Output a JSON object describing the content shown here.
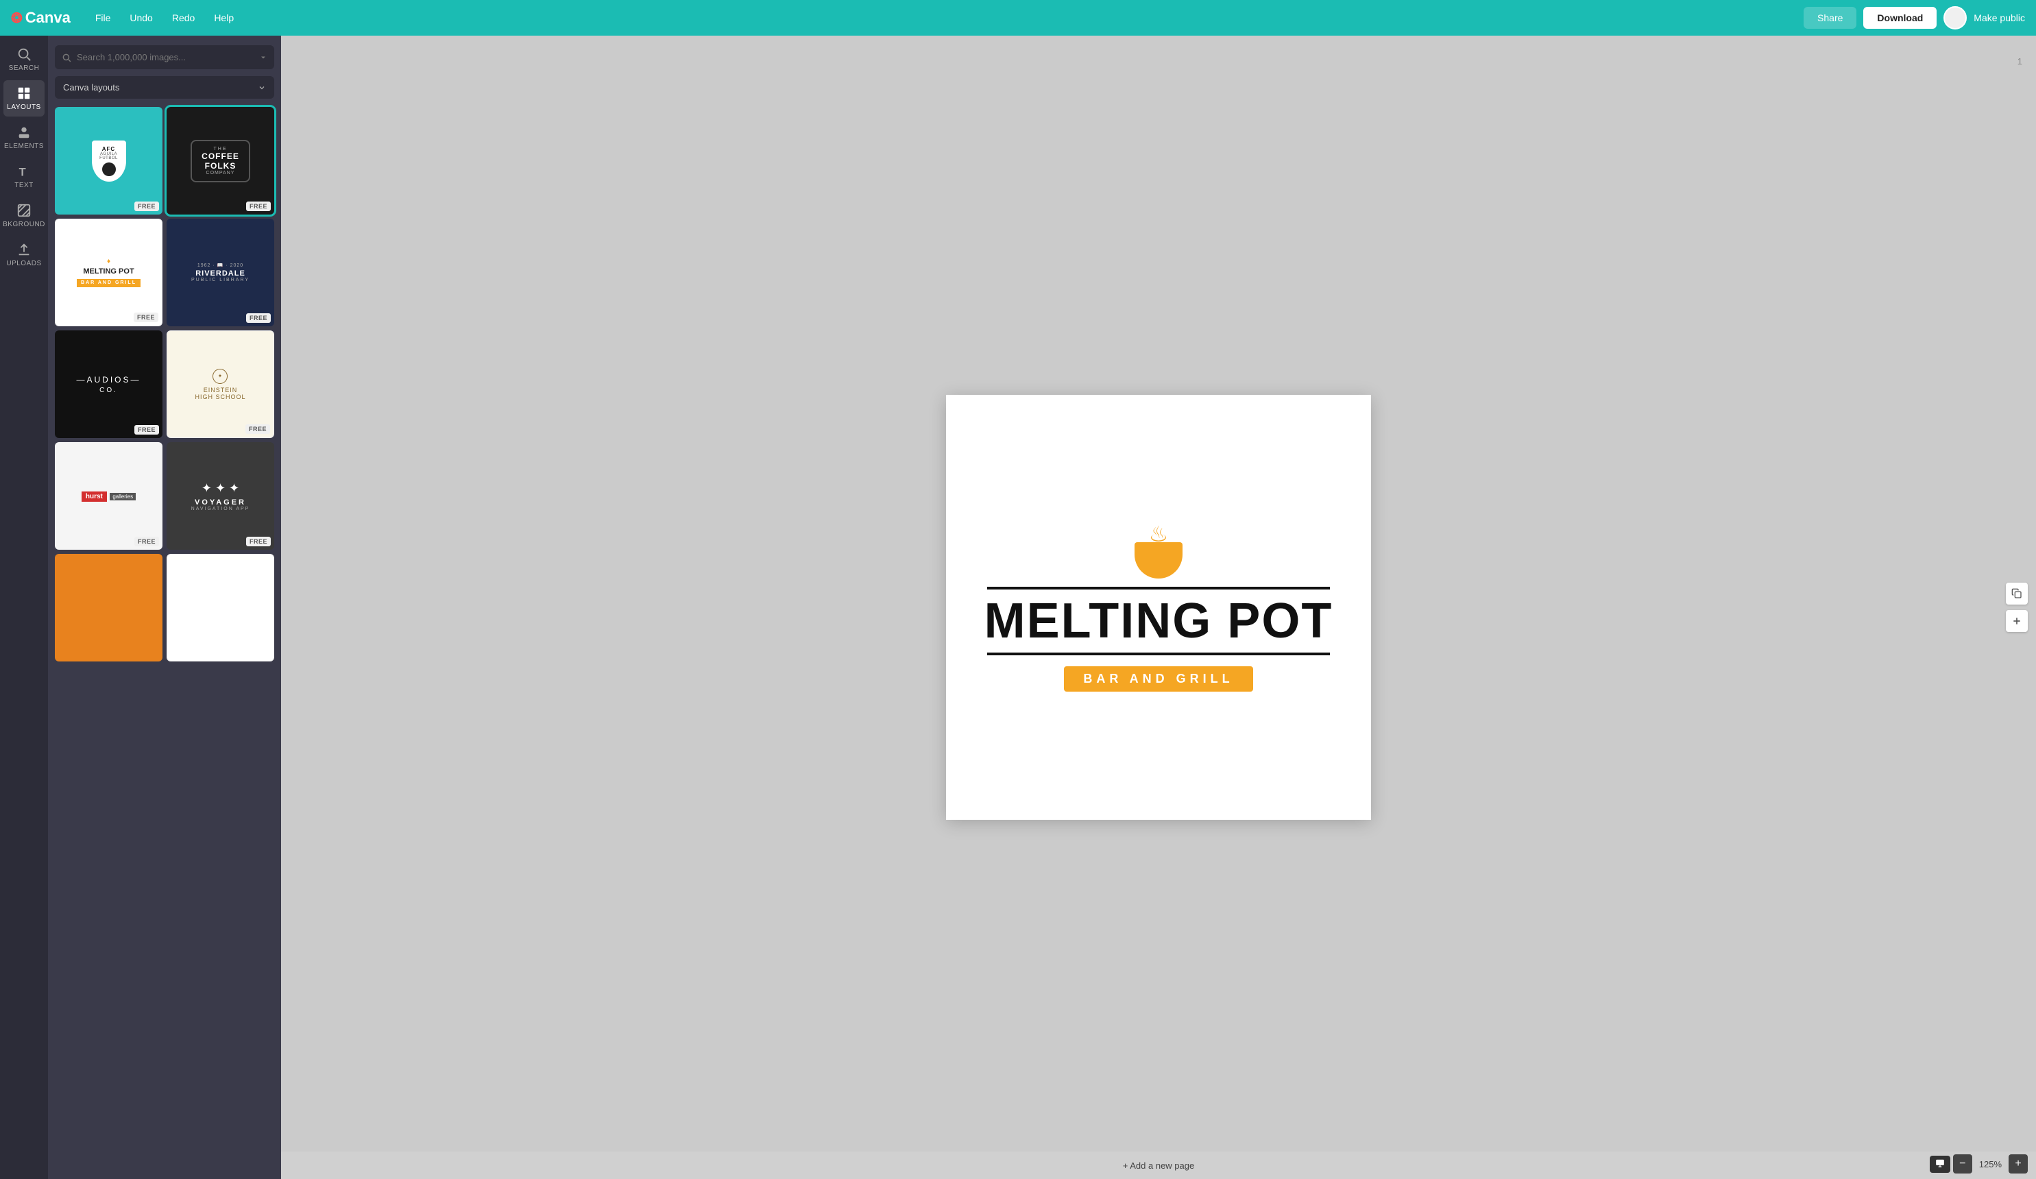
{
  "topbar": {
    "logo": "Canva",
    "menu": [
      "File",
      "Undo",
      "Redo",
      "Help"
    ],
    "share_label": "Share",
    "download_label": "Download",
    "make_public_label": "Make public"
  },
  "sidebar": {
    "items": [
      {
        "id": "search",
        "label": "SEARCH",
        "icon": "search"
      },
      {
        "id": "layouts",
        "label": "LAYOUTS",
        "icon": "layouts",
        "active": true
      },
      {
        "id": "elements",
        "label": "ELEMENTS",
        "icon": "elements"
      },
      {
        "id": "text",
        "label": "TEXT",
        "icon": "text"
      },
      {
        "id": "background",
        "label": "BKGROUND",
        "icon": "background"
      },
      {
        "id": "uploads",
        "label": "UPLOADS",
        "icon": "uploads"
      }
    ]
  },
  "panel": {
    "search_placeholder": "Search 1,000,000 images...",
    "dropdown_label": "Canva layouts",
    "layouts": [
      {
        "id": "afc",
        "type": "afc",
        "free": true,
        "active": false
      },
      {
        "id": "coffee",
        "type": "coffee",
        "free": true,
        "active": true
      },
      {
        "id": "melting",
        "type": "melting",
        "free": true,
        "active": false
      },
      {
        "id": "riverdale",
        "type": "riverdale",
        "free": true,
        "active": false
      },
      {
        "id": "audios",
        "type": "audios",
        "free": true,
        "active": false
      },
      {
        "id": "einstein",
        "type": "einstein",
        "free": true,
        "active": false
      },
      {
        "id": "hurst",
        "type": "hurst",
        "free": true,
        "active": false
      },
      {
        "id": "voyager",
        "type": "voyager",
        "free": true,
        "active": false
      },
      {
        "id": "orange",
        "type": "orange",
        "free": false,
        "active": false
      },
      {
        "id": "white2",
        "type": "white2",
        "free": false,
        "active": false
      }
    ]
  },
  "canvas": {
    "title": "MELTING POT",
    "subtitle": "BAR AND GRILL",
    "page_num": "1"
  },
  "zoom": {
    "level": "125%",
    "minus": "−",
    "plus": "+"
  },
  "bottom": {
    "add_page": "+ Add a new page"
  }
}
